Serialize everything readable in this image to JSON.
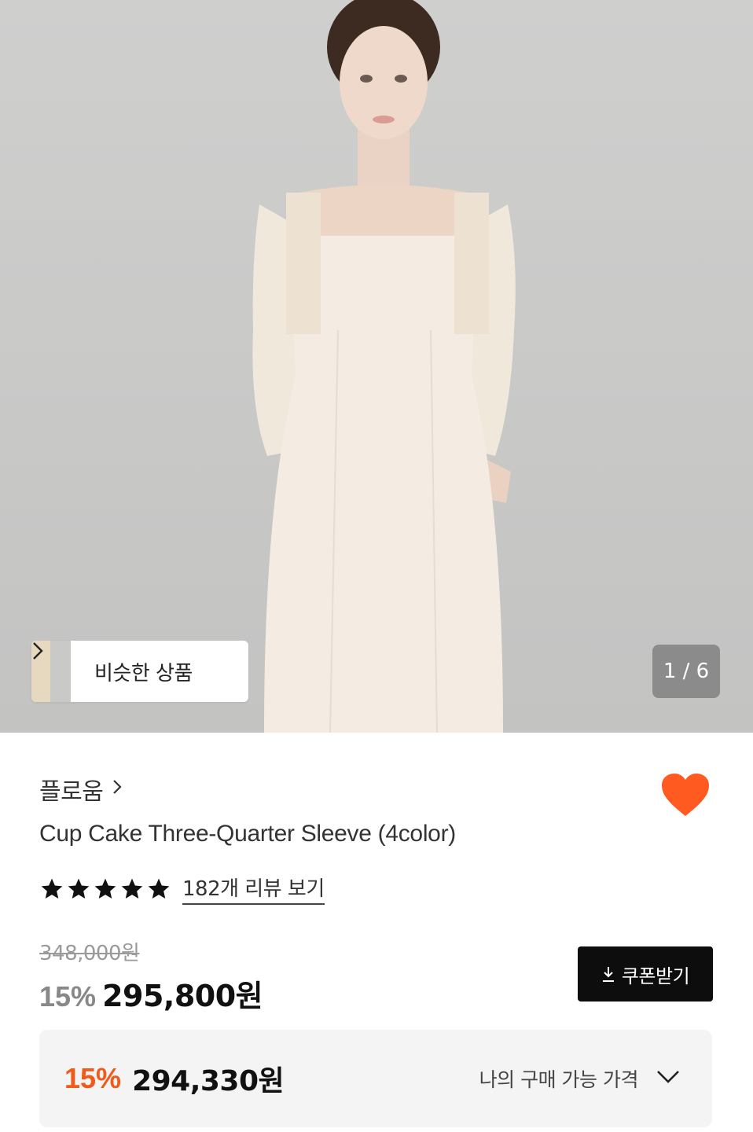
{
  "gallery": {
    "similar_label": "비슷한 상품",
    "counter": "1 / 6"
  },
  "product": {
    "brand": "플로움",
    "title": "Cup Cake Three-Quarter Sleeve (4color)",
    "rating_stars": 5,
    "review_link": "182개 리뷰 보기",
    "original_price": "348,000원",
    "discount": "15%",
    "price": "295,800원",
    "coupon_label": "쿠폰받기",
    "wishlisted": true
  },
  "my_price": {
    "discount": "15%",
    "amount": "294,330원",
    "label": "나의 구매 가능 가격"
  },
  "colors": {
    "accent": "#f05a1a",
    "heart": "#ff5a1f",
    "button_dark": "#0d0d0d"
  }
}
